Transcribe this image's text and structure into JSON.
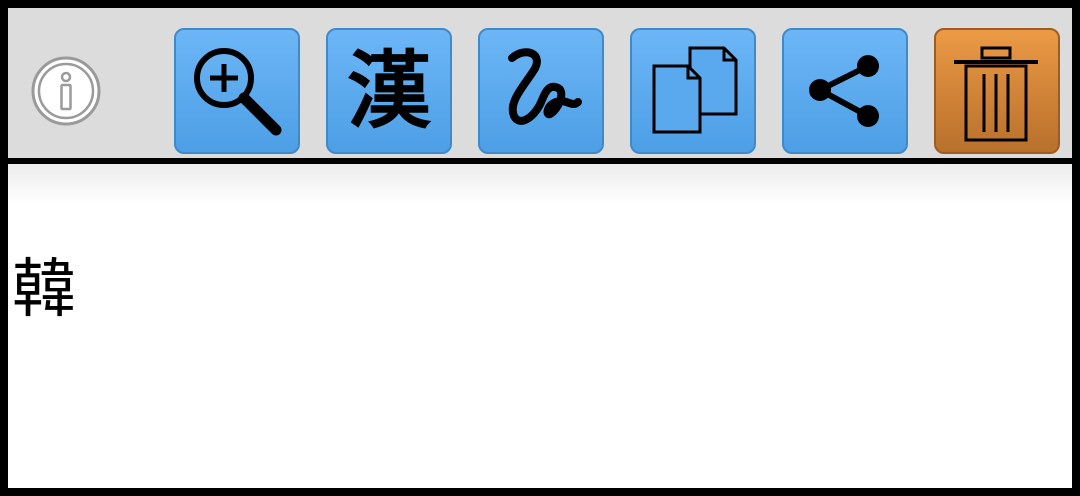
{
  "toolbar": {
    "info": {
      "icon": "info-icon"
    },
    "buttons": [
      {
        "name": "zoom-button",
        "icon": "zoom-in-icon",
        "color": "#5aa8ee"
      },
      {
        "name": "kanji-button",
        "icon": "kanji-icon",
        "glyph": "漢",
        "color": "#5aa8ee"
      },
      {
        "name": "handwriting-button",
        "icon": "handwriting-squiggle-icon",
        "color": "#5aa8ee"
      },
      {
        "name": "copy-button",
        "icon": "copy-icon",
        "color": "#5aa8ee"
      },
      {
        "name": "share-button",
        "icon": "share-icon",
        "color": "#5aa8ee"
      },
      {
        "name": "delete-button",
        "icon": "trash-icon",
        "color": "#d2853a"
      }
    ]
  },
  "content": {
    "text": "韓"
  }
}
